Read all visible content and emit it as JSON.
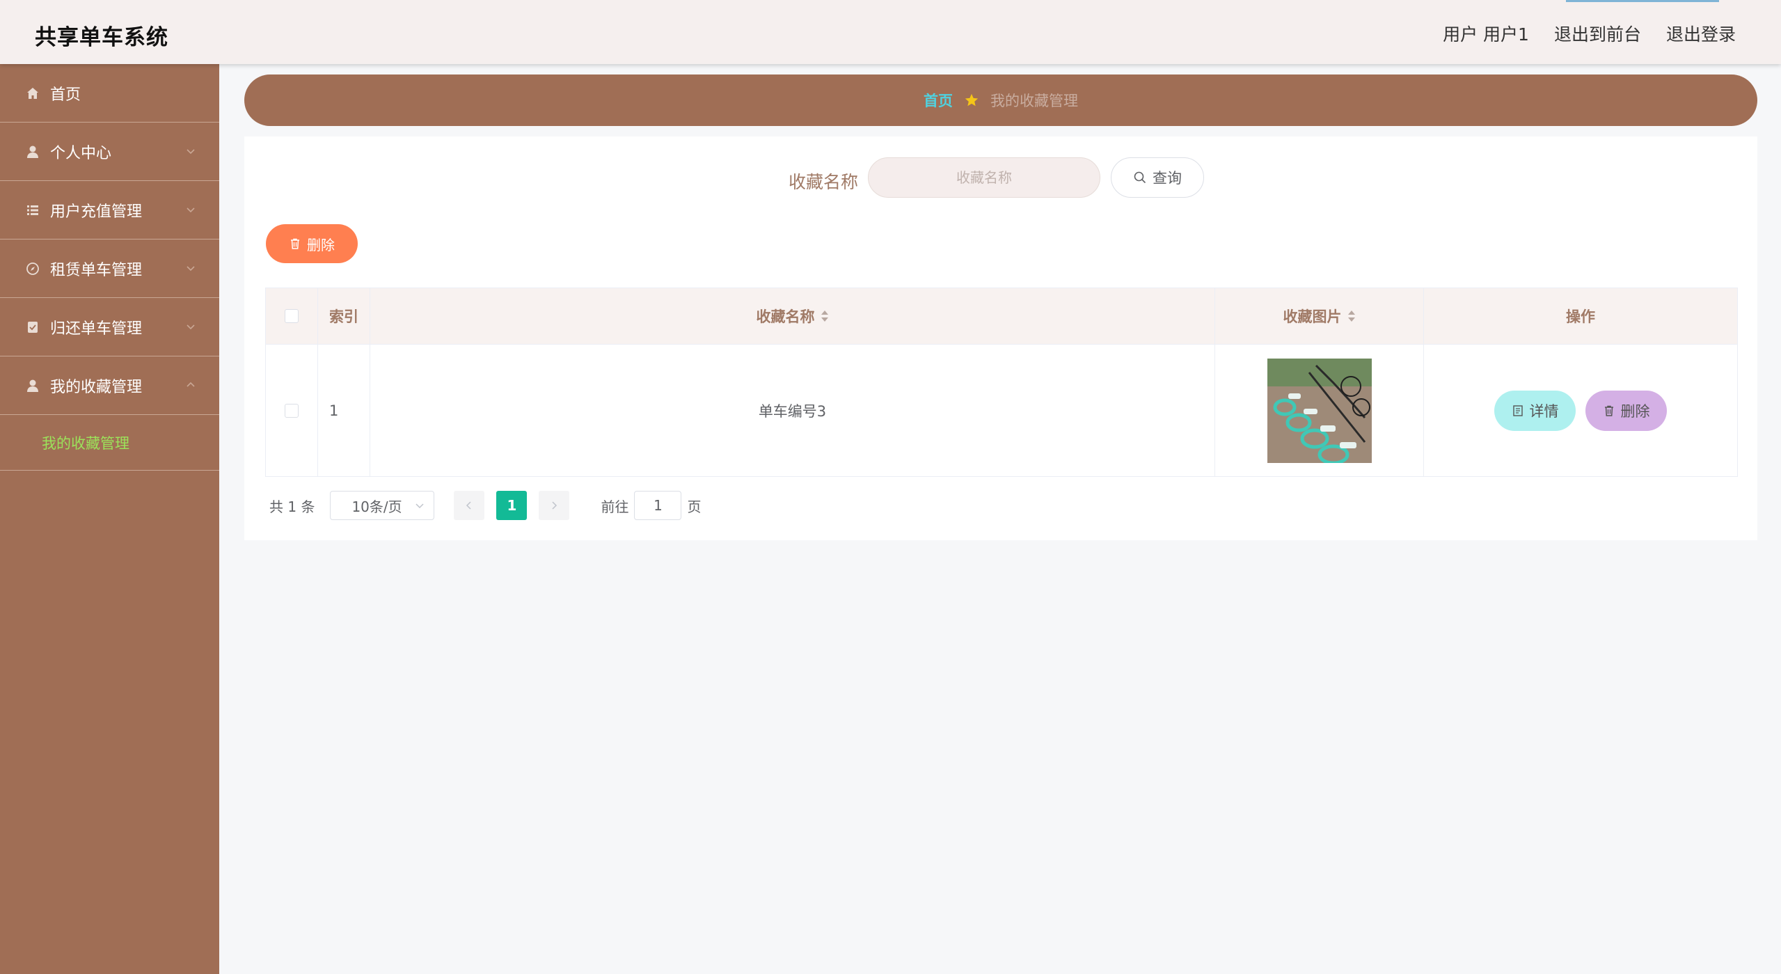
{
  "header": {
    "title": "共享单车系统",
    "user_label": "用户 用户1",
    "to_front": "退出到前台",
    "logout": "退出登录"
  },
  "sidebar": {
    "items": [
      {
        "label": "首页",
        "icon": "home-icon"
      },
      {
        "label": "个人中心",
        "icon": "user-icon"
      },
      {
        "label": "用户充值管理",
        "icon": "list-icon"
      },
      {
        "label": "租赁单车管理",
        "icon": "compass-icon"
      },
      {
        "label": "归还单车管理",
        "icon": "checklist-icon"
      },
      {
        "label": "我的收藏管理",
        "icon": "user-icon"
      }
    ],
    "submenu_active": "我的收藏管理"
  },
  "breadcrumb": {
    "home": "首页",
    "current": "我的收藏管理"
  },
  "search": {
    "label": "收藏名称",
    "placeholder": "收藏名称",
    "value": "",
    "button": "查询"
  },
  "actions": {
    "delete": "删除"
  },
  "table": {
    "headers": {
      "index": "索引",
      "name": "收藏名称",
      "image": "收藏图片",
      "ops": "操作"
    },
    "rows": [
      {
        "index": "1",
        "name": "单车编号3",
        "image": "bicycle-photo",
        "detail": "详情",
        "delete": "删除"
      }
    ]
  },
  "pager": {
    "total": "共 1 条",
    "page_size": "10条/页",
    "current_page": "1",
    "goto_label": "前往",
    "goto_value": "1",
    "page_suffix": "页"
  },
  "colors": {
    "sidebar": "#a06e55",
    "header": "#f5efee",
    "active_submenu": "#9be35a",
    "crumb_home": "#4fd2e0",
    "delete_button": "#ff7f50",
    "detail_button": "#aef0ef",
    "row_delete_button": "#d4b0e5",
    "page_active": "#13ba96"
  }
}
